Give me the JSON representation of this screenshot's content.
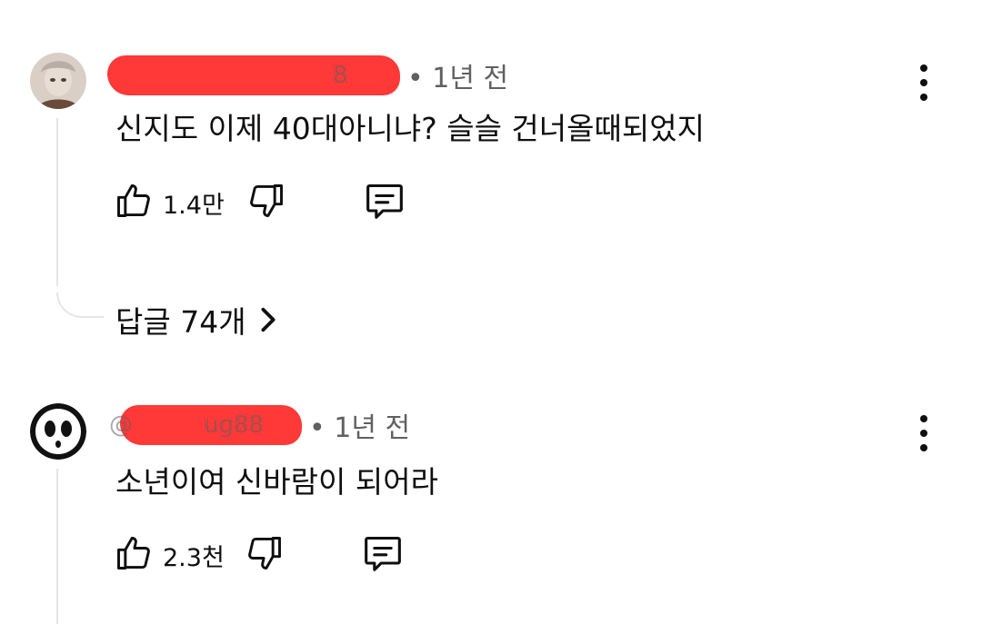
{
  "comments": [
    {
      "author_hidden_prefix": "",
      "author_hidden_tail": "8",
      "time": "• 1년 전",
      "text": "신지도 이제 40대아니냐? 슬슬 건너올때되었지",
      "likes": "1.4만",
      "replies_label": "답글 74개",
      "icons": {
        "like": "thumbs-up-icon",
        "dislike": "thumbs-down-icon",
        "reply": "comment-icon",
        "menu": "more-vert-icon",
        "more": "chevron-right-icon"
      }
    },
    {
      "author_hidden_prefix": "@",
      "author_hidden_tail": "ug88",
      "time": "• 1년 전",
      "text": "소년이여 신바람이 되어라",
      "likes": "2.3천",
      "icons": {
        "like": "thumbs-up-icon",
        "dislike": "thumbs-down-icon",
        "reply": "comment-icon",
        "menu": "more-vert-icon"
      }
    }
  ],
  "colors": {
    "redaction": "#ff3838",
    "meta_text": "#606060",
    "thread_line": "#e5e5e5"
  }
}
